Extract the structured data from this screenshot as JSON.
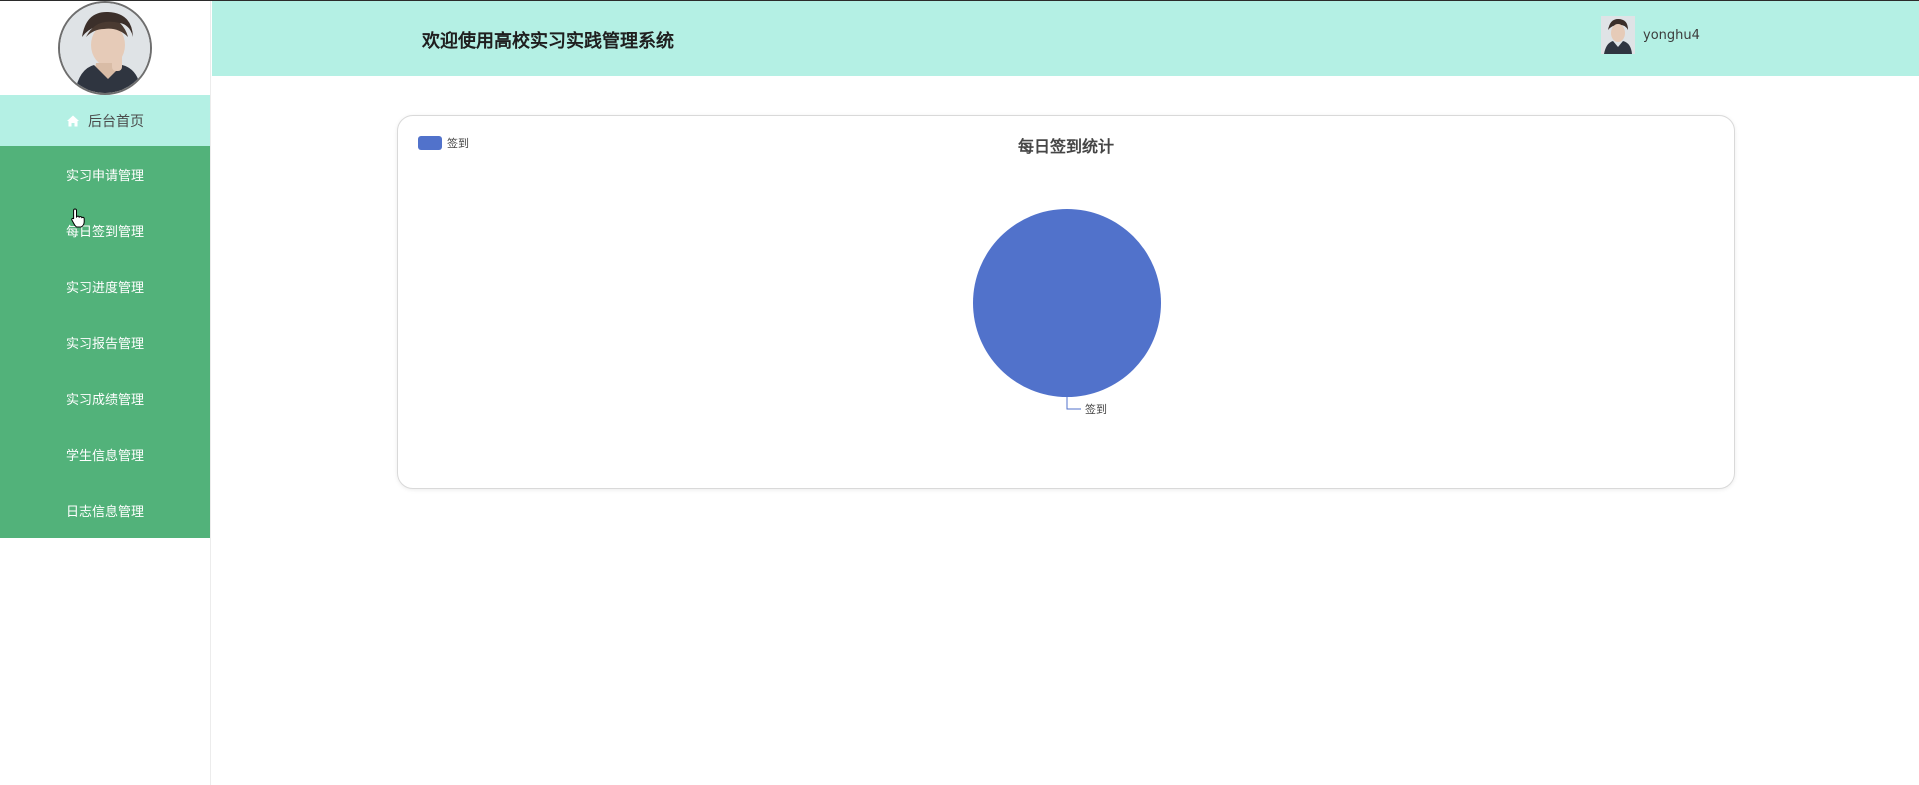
{
  "app": {
    "title": "欢迎使用高校实习实践管理系统"
  },
  "user": {
    "name": "yonghu4",
    "avatar_icon": "user-avatar"
  },
  "sidebar": {
    "home": {
      "label": "后台首页",
      "icon": "home-icon"
    },
    "items": [
      {
        "label": "实习申请管理"
      },
      {
        "label": "每日签到管理"
      },
      {
        "label": "实习进度管理"
      },
      {
        "label": "实习报告管理"
      },
      {
        "label": "实习成绩管理"
      },
      {
        "label": "学生信息管理"
      },
      {
        "label": "日志信息管理"
      }
    ]
  },
  "colors": {
    "header_bg": "#b4f0e4",
    "menu_bg": "#52b27a",
    "series": "#5172cb"
  },
  "chart_data": {
    "type": "pie",
    "title": "每日签到统计",
    "legend": {
      "position": "top-left",
      "entries": [
        "签到"
      ]
    },
    "categories": [
      "签到"
    ],
    "values": [
      1
    ],
    "labels": [
      "签到"
    ]
  }
}
